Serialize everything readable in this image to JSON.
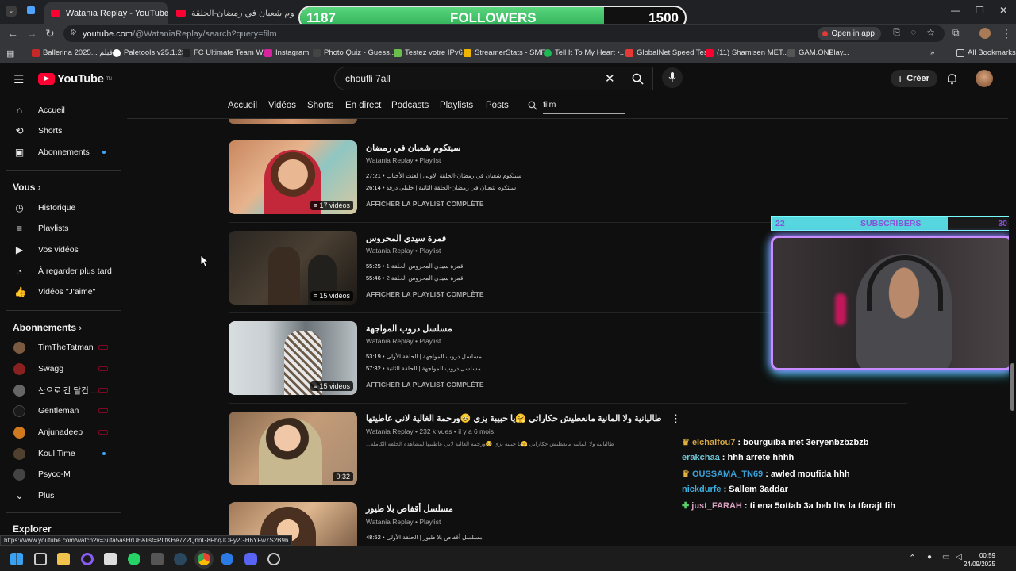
{
  "browser": {
    "tabs": [
      {
        "title": "Watania Replay - YouTube",
        "active": true
      },
      {
        "title": "سيتكوم شعبان في رمضان-الحلقة",
        "active": false
      }
    ],
    "url_host": "youtube.com",
    "url_path": "/@WataniaReplay/search?query=film",
    "open_in_app": "Open in app",
    "bookmarks": [
      "Ballerina 2025... فيلم",
      "Paletools v25.1.23",
      "FC Ultimate Team W...",
      "Instagram",
      "Photo Quiz - Guess...",
      "Testez votre IPv6.",
      "StreamerStats - SMF...",
      "Tell It To My Heart •...",
      "GlobalNet Speed Test",
      "(11) Shamisen MET...",
      "GAM.ONL",
      "Play..."
    ],
    "all_bookmarks": "All Bookmarks",
    "status_url": "https://www.youtube.com/watch?v=3uta5asHrUE&list=PLtKHe7Z2QnnG8FbqJOFy2GH6YFw7S2B96"
  },
  "followers_widget": {
    "current": "1187",
    "label": "FOLLOWERS",
    "goal": "1500",
    "progress": 0.79
  },
  "youtube": {
    "logo_text": "YouTube",
    "logo_sup": "TN",
    "search_value": "choufli 7all",
    "create_label": "Créer",
    "filter_tabs": [
      "Accueil",
      "Vidéos",
      "Shorts",
      "En direct",
      "Podcasts",
      "Playlists",
      "Posts"
    ],
    "filter_value": "film"
  },
  "sidebar": {
    "main": [
      {
        "label": "Accueil",
        "icon": "home-icon"
      },
      {
        "label": "Shorts",
        "icon": "shorts-icon"
      },
      {
        "label": "Abonnements",
        "icon": "subscriptions-icon"
      }
    ],
    "you_heading": "Vous",
    "you": [
      {
        "label": "Historique",
        "icon": "history-icon"
      },
      {
        "label": "Playlists",
        "icon": "playlists-icon"
      },
      {
        "label": "Vos vidéos",
        "icon": "your-videos-icon"
      },
      {
        "label": "À regarder plus tard",
        "icon": "watch-later-icon"
      },
      {
        "label": "Vidéos \"J'aime\"",
        "icon": "like-icon"
      }
    ],
    "subs_heading": "Abonnements",
    "subs": [
      {
        "label": "TimTheTatman",
        "color": "#7a5a40"
      },
      {
        "label": "Swagg",
        "color": "#8a2020"
      },
      {
        "label": "산으로 간 달건 ...",
        "color": "#666666"
      },
      {
        "label": "Gentleman",
        "color": "#1a1a1a"
      },
      {
        "label": "Anjunadeep",
        "color": "#d07a20"
      },
      {
        "label": "Koul Time",
        "color": "#504030"
      },
      {
        "label": "Psyco-M",
        "color": "#444444"
      }
    ],
    "more_label": "Plus",
    "explore_heading": "Explorer"
  },
  "results": [
    {
      "title": "سيتكوم شعبان في رمضان",
      "channel": "Watania Replay • Playlist",
      "lines": [
        {
          "time": "27:21",
          "text": "سيتكوم شعبان في رمضان-الحلقة الأولى | لعنت الأحباب"
        },
        {
          "time": "26:14",
          "text": "سيتكوم شعبان في رمضان-الحلقة الثانية | خليلي درقد"
        }
      ],
      "badge": "17 vidéos",
      "action": "AFFICHER LA PLAYLIST COMPLÈTE"
    },
    {
      "title": "قمرة سيدي المحروس",
      "channel": "Watania Replay • Playlist",
      "lines": [
        {
          "time": "55:25",
          "text": "قمرة سيدي المحروس الحلقة 1"
        },
        {
          "time": "55:46",
          "text": "قمرة سيدي المحروس الحلقة 2"
        }
      ],
      "badge": "15 vidéos",
      "action": "AFFICHER LA PLAYLIST COMPLÈTE"
    },
    {
      "title": "مسلسل دروب المواجهة",
      "channel": "Watania Replay • Playlist",
      "lines": [
        {
          "time": "53:19",
          "text": "مسلسل دروب المواجهة | الحلقة الأولى"
        },
        {
          "time": "57:32",
          "text": "مسلسل دروب المواجهة | الحلقة الثانية"
        }
      ],
      "badge": "15 vidéos",
      "action": "AFFICHER LA PLAYLIST COMPLÈTE"
    },
    {
      "title": "طاليانية ولا المانية مانعطيش حكاراتي 🤗يا حبيبة يزي 🥺ورحمة الغالية لاني عاطيتها",
      "channel": "Watania Replay • 232 k vues • il y a 6 mois",
      "desc": "...طاليانية ولا المانية مانعطيش حكاراتي 🤗يا حبيبة يزي 🥺ورحمة الغالية لاني عاطيتها لمشاهدة الحلقة الكاملة",
      "badge": "0:32"
    },
    {
      "title": "مسلسل أقفاص بلا طيور",
      "channel": "Watania Replay • Playlist",
      "lines": [
        {
          "time": "48:52",
          "text": "مسلسل أقفاص بلا طيور | الحلقة الأولى"
        }
      ]
    }
  ],
  "subscribers_widget": {
    "current": "22",
    "label": "SUBSCRIBERS",
    "goal": "30",
    "progress": 0.73
  },
  "chat": [
    {
      "user": "elchalfou7",
      "msg": ": bourguiba met 3eryenbzbzbzb",
      "badge": true
    },
    {
      "user": "erakchaa",
      "msg": ": hhh arrete hhhh",
      "badge": false
    },
    {
      "user": "OUSSAMA_TN69",
      "msg": ": awled moufida hhh",
      "badge": true
    },
    {
      "user": "nickdurfe",
      "msg": ": Sallem 3addar",
      "badge": false
    },
    {
      "user": "just_FARAH",
      "msg": ": ti ena 5ottab 3a beb ltw la tfarajt fih",
      "badge": true
    }
  ],
  "clock": {
    "time": "00:59",
    "date": "24/09/2025"
  }
}
